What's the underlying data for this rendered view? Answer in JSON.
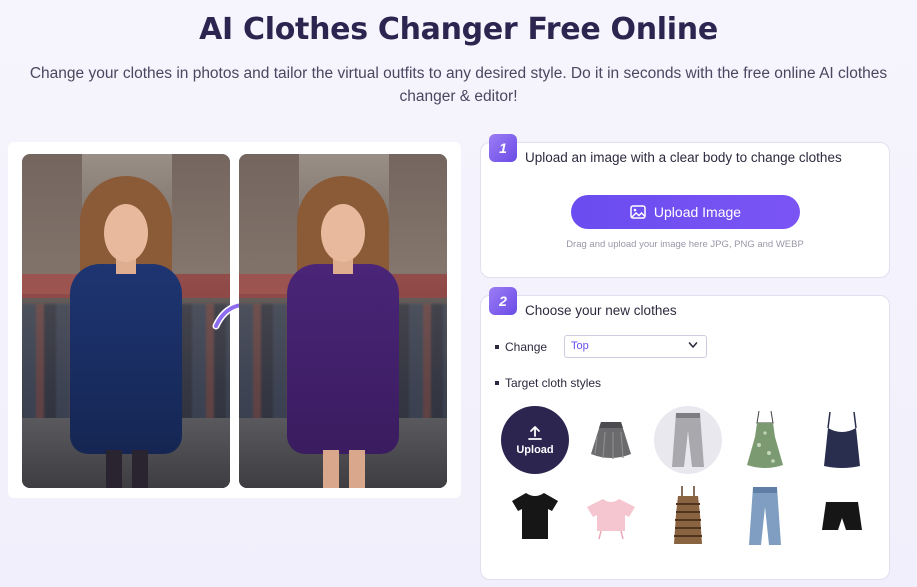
{
  "header": {
    "title": "AI Clothes Changer Free Online",
    "subtitle": "Change your clothes in photos and tailor the virtual outfits to any desired style. Do it in seconds with the free online AI clothes changer & editor!"
  },
  "step1": {
    "number": "1",
    "title": "Upload an image with a clear body to change clothes",
    "button_label": "Upload Image",
    "hint": "Drag and upload your image here JPG, PNG and WEBP"
  },
  "step2": {
    "number": "2",
    "title": "Choose your new clothes",
    "change_label": "Change",
    "change_value": "Top",
    "target_label": "Target cloth styles",
    "upload_tile_label": "Upload",
    "cloth_items": [
      {
        "icon": "gray-skirt-icon"
      },
      {
        "icon": "gray-pants-icon"
      },
      {
        "icon": "green-floral-dress-icon"
      },
      {
        "icon": "navy-camisole-icon"
      },
      {
        "icon": "black-tshirt-icon"
      },
      {
        "icon": "pink-crop-top-icon"
      },
      {
        "icon": "striped-dress-icon"
      },
      {
        "icon": "blue-jeans-icon"
      },
      {
        "icon": "black-shorts-icon"
      }
    ]
  },
  "colors": {
    "accent": "#6a4cf0",
    "title": "#2b2550",
    "before_dress": "#1e3572",
    "after_dress": "#4a2578"
  }
}
